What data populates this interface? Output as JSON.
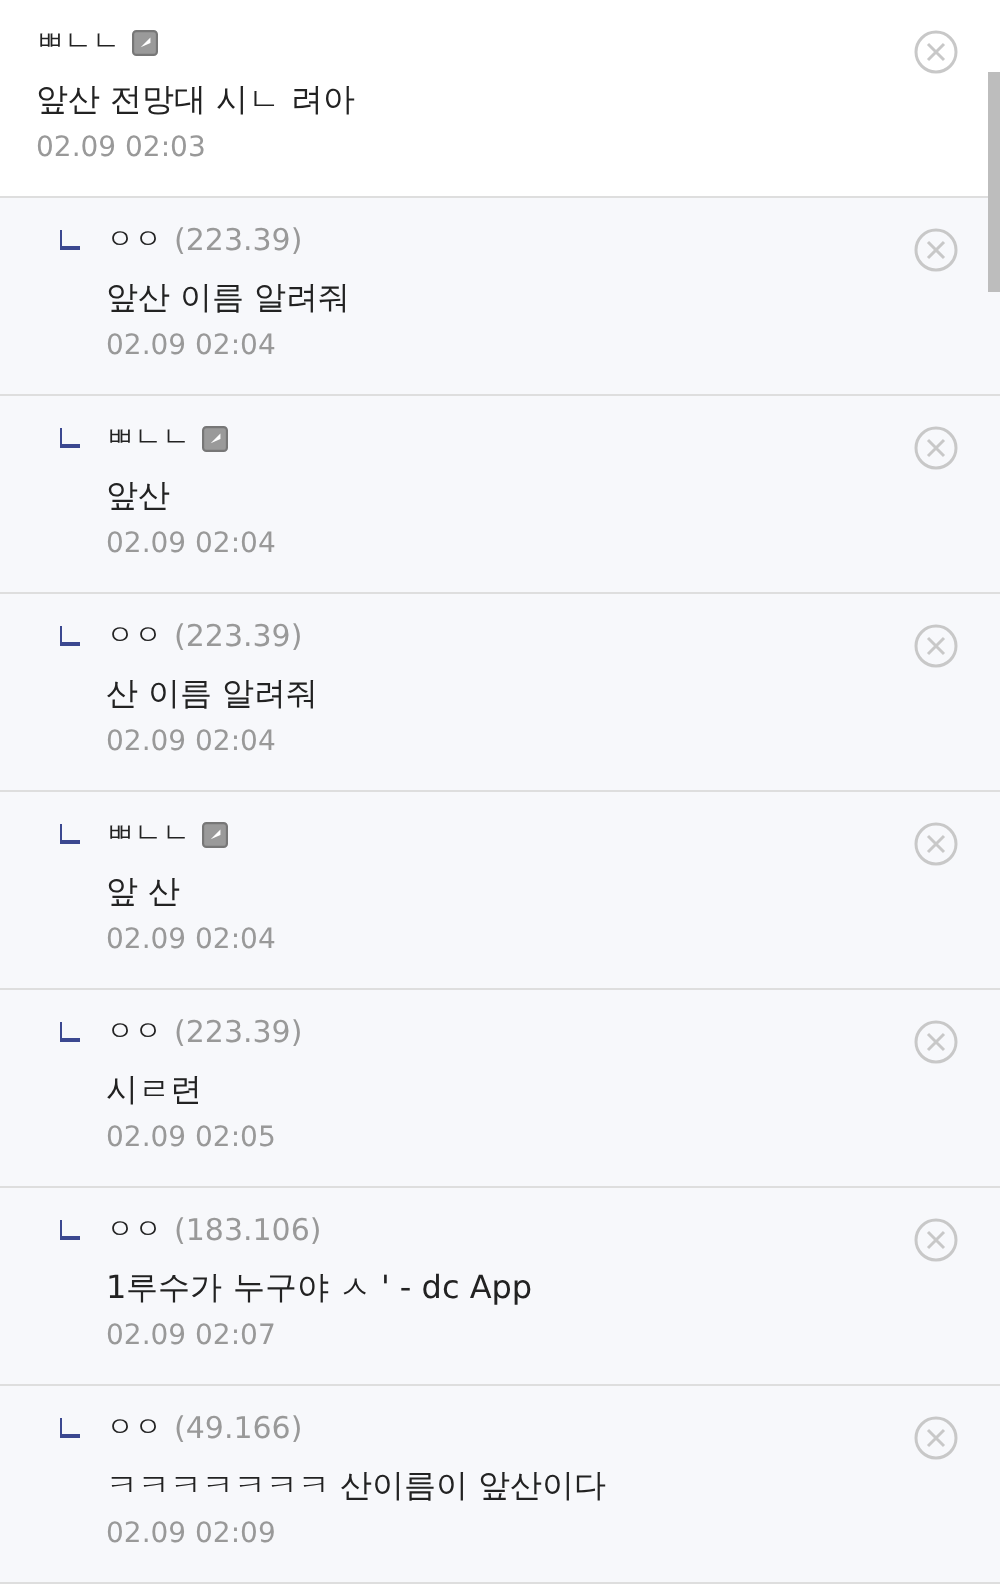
{
  "comments": [
    {
      "reply": false,
      "nickname": "ㅃㄴㄴ",
      "member_icon": true,
      "text": "앞산 전망대 시ㄴ 려아",
      "time": "02.09 02:03"
    },
    {
      "reply": true,
      "nickname": "ㅇㅇ",
      "ip": "(223.39)",
      "member_icon": false,
      "text": "앞산 이름 알려줘",
      "time": "02.09 02:04"
    },
    {
      "reply": true,
      "nickname": "ㅃㄴㄴ",
      "member_icon": true,
      "text": "앞산",
      "time": "02.09 02:04"
    },
    {
      "reply": true,
      "nickname": "ㅇㅇ",
      "ip": "(223.39)",
      "member_icon": false,
      "text": "산 이름 알려줘",
      "time": "02.09 02:04"
    },
    {
      "reply": true,
      "nickname": "ㅃㄴㄴ",
      "member_icon": true,
      "text": "앞 산",
      "time": "02.09 02:04"
    },
    {
      "reply": true,
      "nickname": "ㅇㅇ",
      "ip": "(223.39)",
      "member_icon": false,
      "text": "시ㄹ련",
      "time": "02.09 02:05"
    },
    {
      "reply": true,
      "nickname": "ㅇㅇ",
      "ip": "(183.106)",
      "member_icon": false,
      "text": "1루수가 누구야 ㅅ ' - dc App",
      "time": "02.09 02:07"
    },
    {
      "reply": true,
      "nickname": "ㅇㅇ",
      "ip": "(49.166)",
      "member_icon": false,
      "text": "ㅋㅋㅋㅋㅋㅋㅋ 산이름이 앞산이다",
      "time": "02.09 02:09"
    }
  ]
}
